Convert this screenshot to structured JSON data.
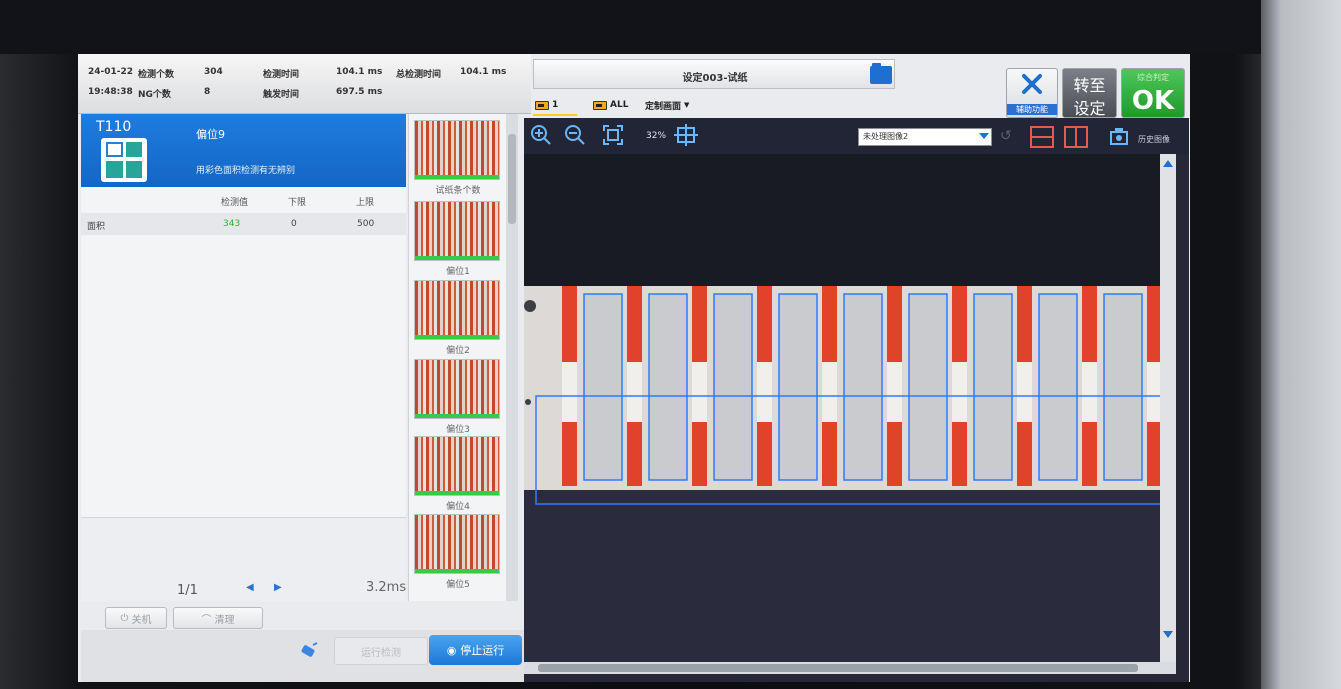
{
  "info": {
    "date": "24-01-22",
    "time": "19:48:38",
    "detect_count_label": "检测个数",
    "detect_count": "304",
    "ng_count_label": "NG个数",
    "ng_count": "8",
    "detect_time_label": "检测时间",
    "detect_time": "104.1 ms",
    "total_time_label": "总检测时间",
    "total_time": "104.1 ms",
    "trigger_time_label": "触发时间",
    "trigger_time": "697.5 ms"
  },
  "detector": {
    "code": "T110",
    "name": "偏位9",
    "description": "用彩色面积检测有无辨别",
    "icon": "color-area-tool-icon"
  },
  "results": {
    "headers": [
      "检测值",
      "下限",
      "上限"
    ],
    "rows": [
      {
        "name": "面积",
        "value": "343",
        "low": "0",
        "high": "500"
      }
    ]
  },
  "pagination": {
    "page": "1/1",
    "time": "3.2ms"
  },
  "left_buttons": {
    "close": "关机",
    "clear": "清理"
  },
  "bottom_buttons": {
    "run_once": "运行检测",
    "stop": "停止运行"
  },
  "thumbnails": [
    {
      "label": "试纸条个数"
    },
    {
      "label": "偏位1"
    },
    {
      "label": "偏位2"
    },
    {
      "label": "偏位3"
    },
    {
      "label": "偏位4"
    },
    {
      "label": "偏位5"
    }
  ],
  "title": "设定003-试纸",
  "tabs": [
    {
      "label": "1"
    },
    {
      "label": "ALL"
    },
    {
      "label": "定制画面"
    }
  ],
  "right_buttons": {
    "assist": "辅助功能",
    "goto_line1": "转至",
    "goto_line2": "设定",
    "ok_top": "综合判定",
    "ok": "OK"
  },
  "viewer": {
    "zoom": "32%",
    "image_select": "未处理图像2",
    "history": "历史图像"
  },
  "colors": {
    "accent": "#1e7de0",
    "ok": "#2aad36",
    "value_green": "#2fae3a",
    "roi_blue": "#2f7bff",
    "strip_red": "#e0432a"
  }
}
